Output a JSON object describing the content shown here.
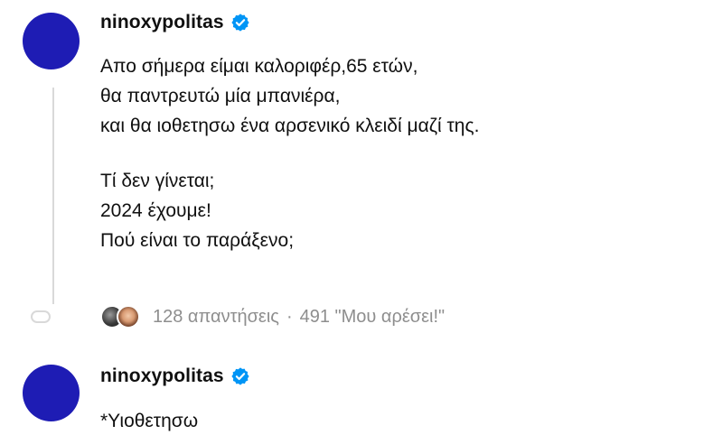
{
  "thread": [
    {
      "username": "ninoxypolitas",
      "verified": true,
      "avatar_color": "#1e1cb4",
      "paragraphs": [
        [
          "Απο σήμερα είμαι καλοριφέρ,65 ετών,",
          "θα παντρευτώ μία μπανιέρα,",
          "και θα ιοθετησω ένα αρσενικό κλειδί μαζί της."
        ],
        [
          "Τί δεν γίνεται;",
          "2024 έχουμε!",
          "Πού είναι το παράξενο;"
        ]
      ],
      "engagement": {
        "replies_text": "128 απαντήσεις",
        "separator": "·",
        "likes_text": "491 \"Μου αρέσει!\""
      }
    },
    {
      "username": "ninoxypolitas",
      "verified": true,
      "avatar_color": "#1e1cb4",
      "text": "*Υιοθετησω"
    }
  ],
  "colors": {
    "verified_badge": "#0095f6",
    "secondary_text": "#8e8e8e",
    "thread_line": "#d9d9d9"
  },
  "icons": {
    "verified": "verified-badge-icon",
    "thread_end": "thread-loop-icon"
  }
}
